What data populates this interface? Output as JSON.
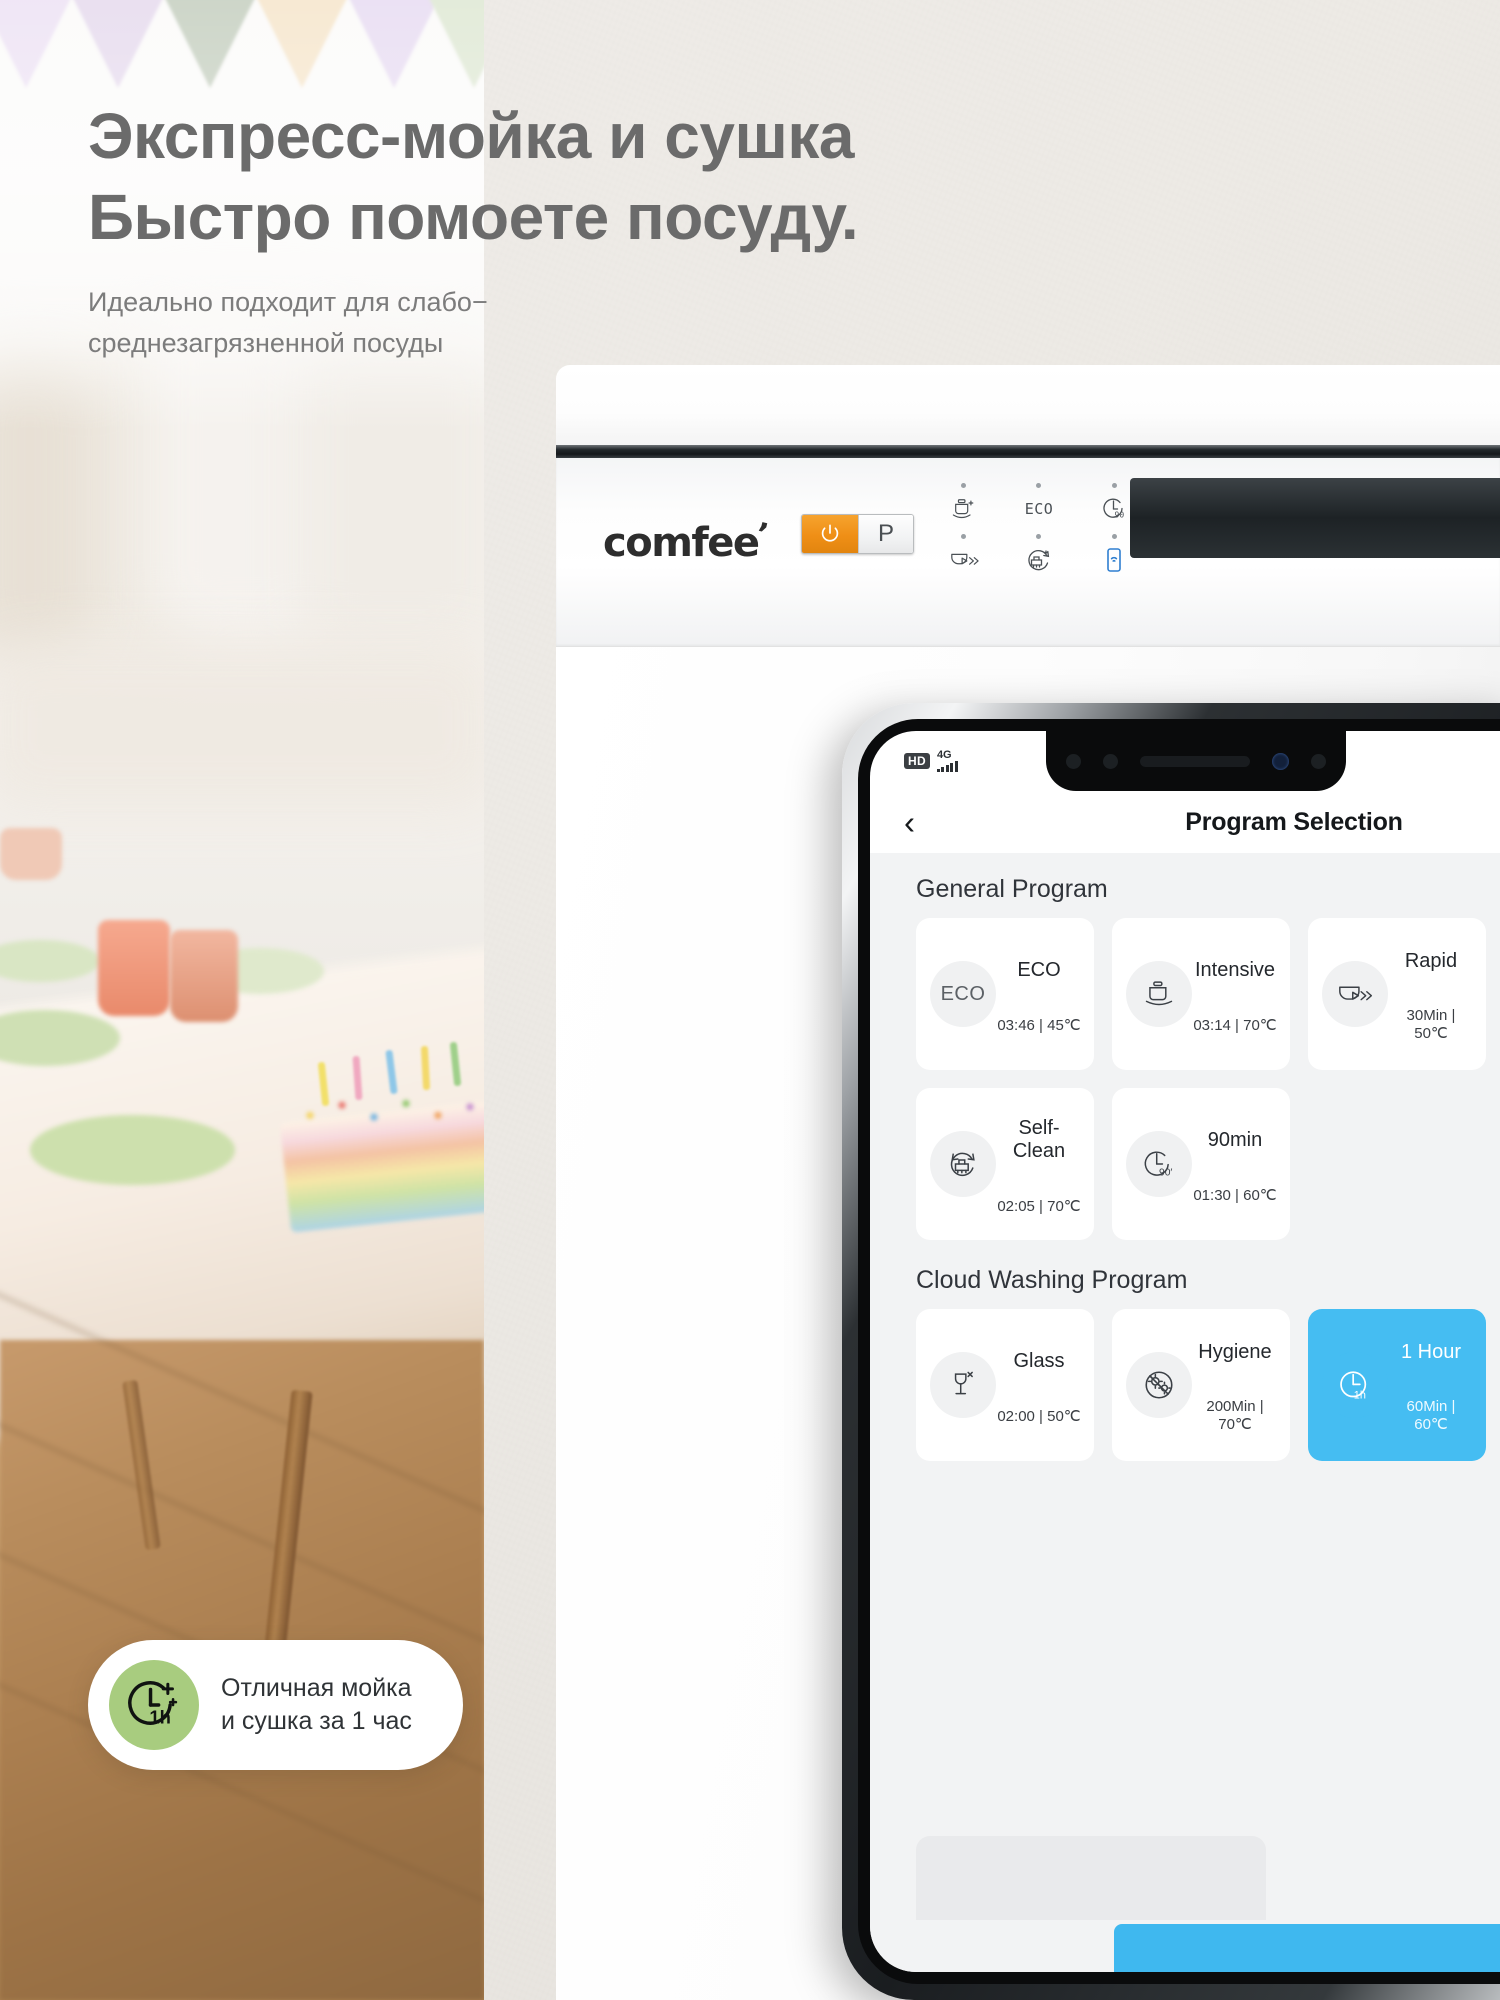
{
  "headline": {
    "line1": "Экспресс-мойка и сушка",
    "line2": "Быстро помоете посуду."
  },
  "subheadline": {
    "line1": "Идеально подходит для слабо−",
    "line2": "среднезагрязненной посуды"
  },
  "badge": {
    "icon": "clock-1h-sparkle-icon",
    "icon_label": "1h",
    "line1": "Отличная мойка",
    "line2": "и сушка за 1 час",
    "circle_color": "#a8cc7f"
  },
  "appliance": {
    "brand": "comfee",
    "brand_mark": "’",
    "power_button_label": "power-icon",
    "program_button_label": "P",
    "accent_color": "#ef8f16",
    "indicators": [
      {
        "icon": "intensive-pot-icon",
        "label": ""
      },
      {
        "icon": "eco-text-icon",
        "label": "ECO"
      },
      {
        "icon": "timer-90-icon",
        "label": "90"
      },
      {
        "icon": "rapid-icon",
        "label": ""
      },
      {
        "icon": "self-clean-icon",
        "label": ""
      },
      {
        "icon": "phone-wifi-icon",
        "label": "",
        "color": "#2f7fd0"
      }
    ]
  },
  "phone": {
    "statusbar": {
      "hd": "HD",
      "network": "4G"
    },
    "appbar": {
      "back_icon": "chevron-left-icon",
      "title": "Program Selection"
    },
    "sections": [
      {
        "title": "General Program",
        "cards": [
          {
            "icon": "eco-circle-icon",
            "icon_text": "ECO",
            "name": "ECO",
            "meta": "03:46 | 45℃",
            "active": false
          },
          {
            "icon": "pot-icon",
            "icon_text": "",
            "name": "Intensive",
            "meta": "03:14 | 70℃",
            "active": false
          },
          {
            "icon": "rapid-icon",
            "icon_text": "",
            "name": "Rapid",
            "meta": "30Min | 50℃",
            "active": false
          },
          {
            "icon": "self-clean-icon",
            "icon_text": "",
            "name": "Self-Clean",
            "meta": "02:05 | 70℃",
            "active": false
          },
          {
            "icon": "clock-90-icon",
            "icon_text": "90′",
            "name": "90min",
            "meta": "01:30 | 60℃",
            "active": false
          }
        ]
      },
      {
        "title": "Cloud Washing Program",
        "cards": [
          {
            "icon": "glass-icon",
            "icon_text": "",
            "name": "Glass",
            "meta": "02:00 | 50℃",
            "active": false
          },
          {
            "icon": "hygiene-germ-icon",
            "icon_text": "",
            "name": "Hygiene",
            "meta": "200Min | 70℃",
            "active": false
          },
          {
            "icon": "clock-1h-icon",
            "icon_text": "1h",
            "name": "1 Hour",
            "meta": "60Min | 60℃",
            "active": true
          }
        ]
      }
    ],
    "active_color": "#45bdf2"
  }
}
